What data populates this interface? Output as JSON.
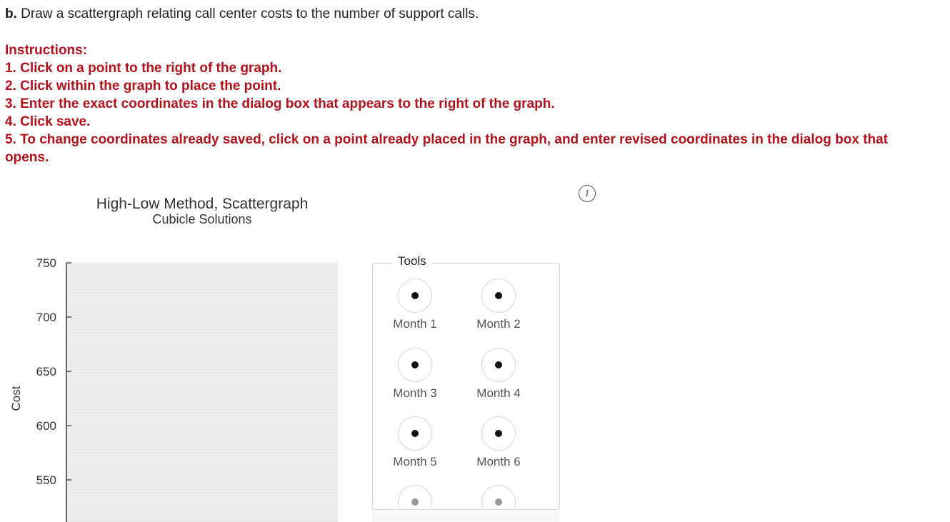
{
  "question": {
    "prefix": "b.",
    "text": "Draw a scattergraph relating call center costs to the number of support calls."
  },
  "instructions": {
    "title": "Instructions:",
    "steps": [
      "1. Click on a point to the right of the graph.",
      "2. Click within the graph to place the point.",
      "3. Enter the exact coordinates in the dialog box that appears to the right of the graph.",
      "4. Click save.",
      "5. To change coordinates already saved, click on a point already placed in the graph, and enter revised coordinates in the dialog box that opens."
    ]
  },
  "info_icon": "info-icon",
  "chart": {
    "title": "High-Low Method, Scattergraph",
    "subtitle": "Cubicle Solutions",
    "ylabel": "Cost"
  },
  "chart_data": {
    "type": "scatter",
    "title": "High-Low Method, Scattergraph",
    "subtitle": "Cubicle Solutions",
    "xlabel": "",
    "ylabel": "Cost",
    "y_ticks": [
      750,
      700,
      650,
      600,
      550
    ],
    "ylim": [
      515,
      750
    ],
    "grid": true,
    "series": []
  },
  "tools": {
    "legend": "Tools",
    "items": [
      {
        "label": "Month 1"
      },
      {
        "label": "Month 2"
      },
      {
        "label": "Month 3"
      },
      {
        "label": "Month 4"
      },
      {
        "label": "Month 5"
      },
      {
        "label": "Month 6"
      },
      {
        "label": ""
      },
      {
        "label": ""
      }
    ]
  }
}
